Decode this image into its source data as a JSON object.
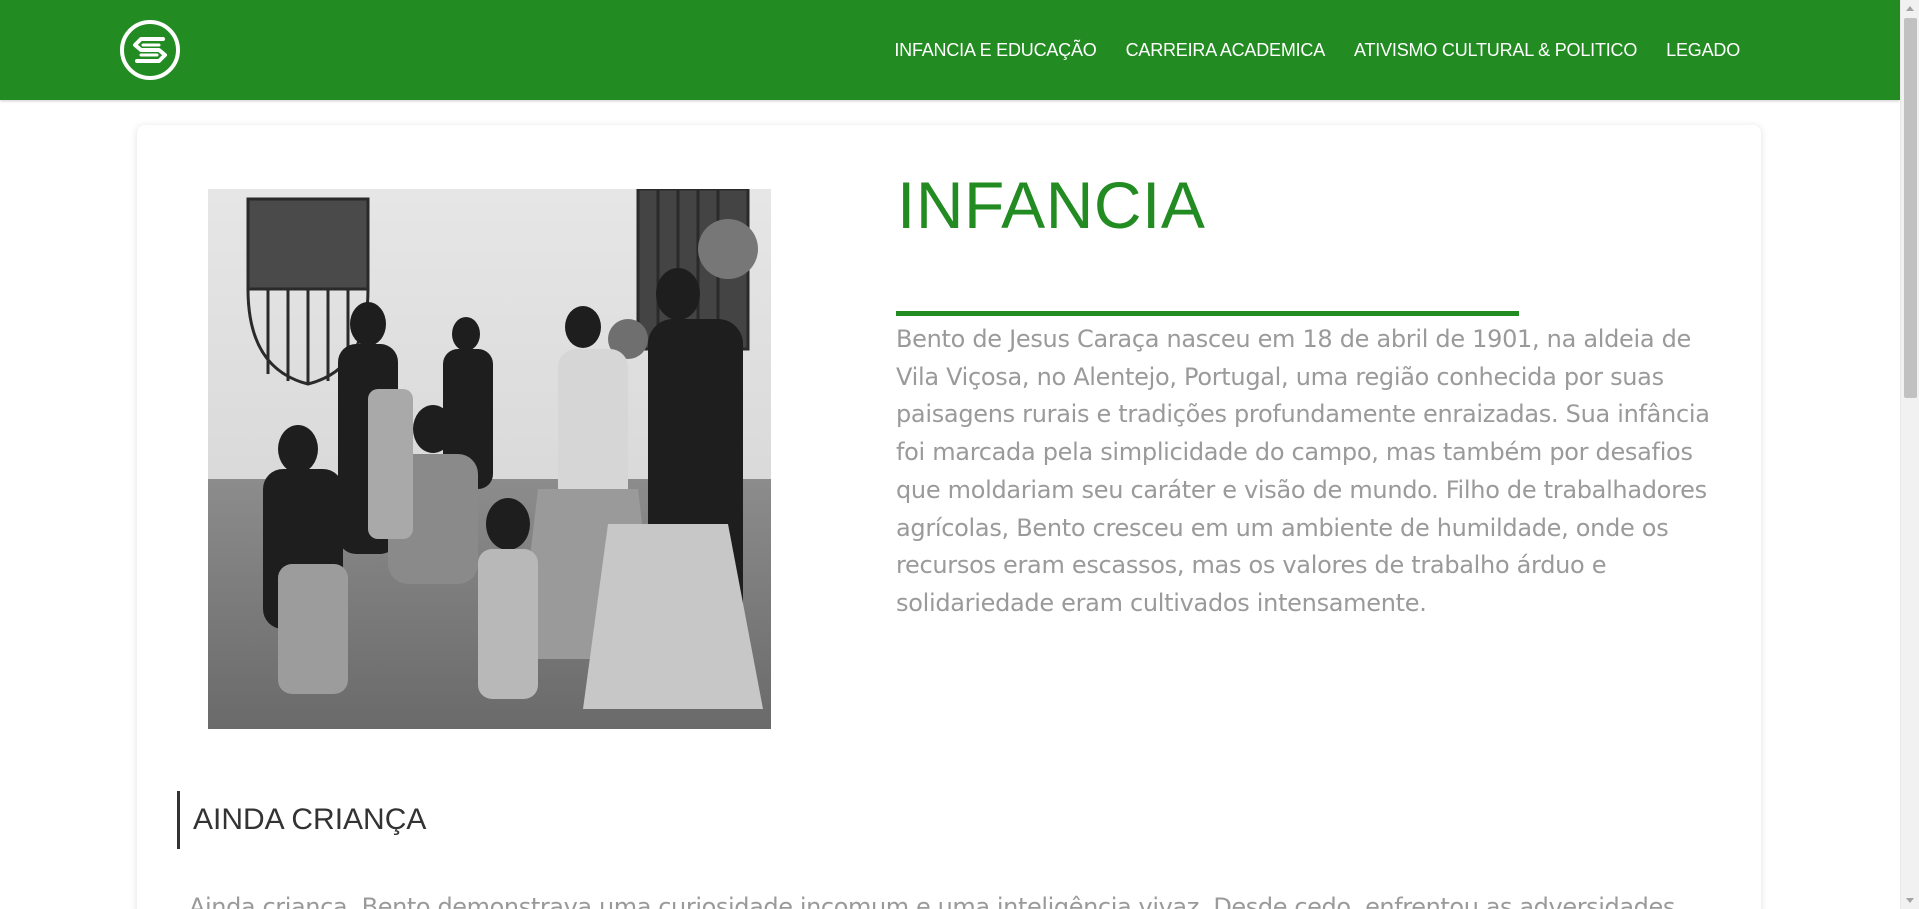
{
  "nav": {
    "logo_icon": "stylized-s-circle-logo-icon",
    "links": [
      "INFANCIA E EDUCAÇÃO",
      "CARREIRA ACADEMICA",
      "ATIVISMO CULTURAL & POLITICO",
      "LEGADO"
    ]
  },
  "main": {
    "photo_icon": "family-photo-image",
    "title": "INFANCIA",
    "intro": "Bento de Jesus Caraça nasceu em 18 de abril de 1901, na aldeia de Vila Viçosa, no Alentejo, Portugal, uma região conhecida por suas paisagens rurais e tradições profundamente enraizadas. Sua infância foi marcada pela simplicidade do campo, mas também por desafios que moldariam seu caráter e visão de mundo. Filho de trabalhadores agrícolas, Bento cresceu em um ambiente de humildade, onde os recursos eram escassos, mas os valores de trabalho árduo e solidariedade eram cultivados intensamente.",
    "subheading": "AINDA CRIANÇA",
    "body": "Ainda criança, Bento demonstrava uma curiosidade incomum e uma inteligência vivaz. Desde cedo, enfrentou as adversidades"
  },
  "colors": {
    "brand_green": "#228b22",
    "text_gray": "#9a9a9a",
    "heading_dark": "#333333"
  }
}
